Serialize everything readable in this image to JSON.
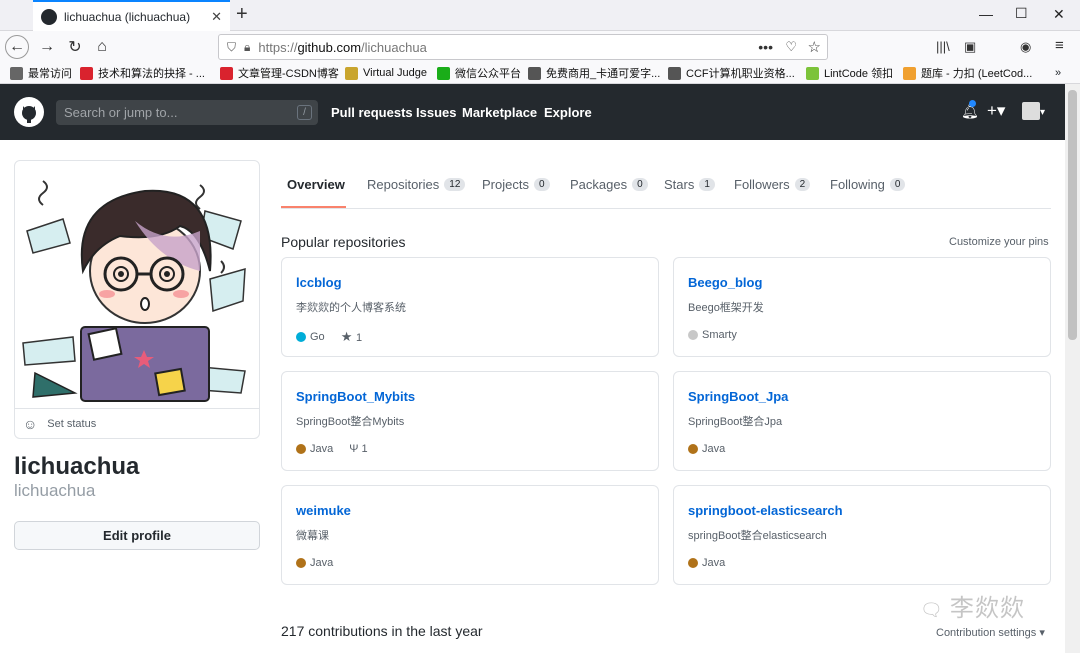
{
  "browser": {
    "tab_title": "lichuachua (lichuachua)",
    "url_proto": "https://",
    "url_host": "github.com",
    "url_path": "/lichuachua",
    "bookmarks": [
      {
        "label": "最常访问",
        "color": "#666"
      },
      {
        "label": "技术和算法的抉择 - ...",
        "color": "#d9232e"
      },
      {
        "label": "文章管理-CSDN博客",
        "color": "#d9232e"
      },
      {
        "label": "Virtual Judge",
        "color": "#c9a52e"
      },
      {
        "label": "微信公众平台",
        "color": "#1aad19"
      },
      {
        "label": "免费商用_卡通可爱字...",
        "color": "#555"
      },
      {
        "label": "CCF计算机职业资格...",
        "color": "#555"
      },
      {
        "label": "LintCode 领扣",
        "color": "#7cc33a"
      },
      {
        "label": "题库 - 力扣 (LeetCod...",
        "color": "#f0a030"
      }
    ]
  },
  "github": {
    "search_placeholder": "Search or jump to...",
    "slash": "/",
    "nav": [
      "Pull requests",
      "Issues",
      "Marketplace",
      "Explore"
    ]
  },
  "profile": {
    "set_status": "Set status",
    "fullname": "lichuachua",
    "username": "lichuachua",
    "edit_profile": "Edit profile"
  },
  "tabs": [
    {
      "label": "Overview",
      "count": null
    },
    {
      "label": "Repositories",
      "count": "12"
    },
    {
      "label": "Projects",
      "count": "0"
    },
    {
      "label": "Packages",
      "count": "0"
    },
    {
      "label": "Stars",
      "count": "1"
    },
    {
      "label": "Followers",
      "count": "2"
    },
    {
      "label": "Following",
      "count": "0"
    }
  ],
  "popular_title": "Popular repositories",
  "customize_pins": "Customize your pins",
  "repos": [
    {
      "name": "lccblog",
      "desc": "李欻欻的个人博客系统",
      "lang": "Go",
      "color": "#00add8",
      "stars": "1",
      "forks": null
    },
    {
      "name": "Beego_blog",
      "desc": "Beego框架开发",
      "lang": "Smarty",
      "color": "#c8c8c8",
      "stars": null,
      "forks": null
    },
    {
      "name": "SpringBoot_Mybits",
      "desc": "SpringBoot整合Mybits",
      "lang": "Java",
      "color": "#b07219",
      "stars": null,
      "forks": "1"
    },
    {
      "name": "SpringBoot_Jpa",
      "desc": "SpringBoot整合Jpa",
      "lang": "Java",
      "color": "#b07219",
      "stars": null,
      "forks": null
    },
    {
      "name": "weimuke",
      "desc": "微幕课",
      "lang": "Java",
      "color": "#b07219",
      "stars": null,
      "forks": null
    },
    {
      "name": "springboot-elasticsearch",
      "desc": "springBoot整合elasticsearch",
      "lang": "Java",
      "color": "#b07219",
      "stars": null,
      "forks": null
    }
  ],
  "contributions": "217 contributions in the last year",
  "contribution_settings": "Contribution settings ▾",
  "watermark": "李欻欻"
}
